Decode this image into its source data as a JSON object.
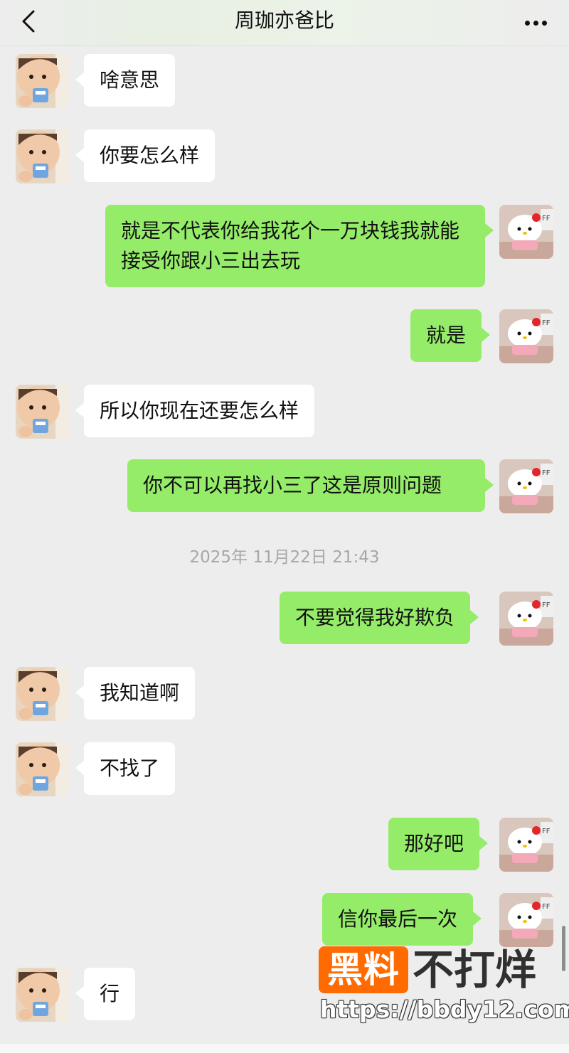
{
  "header": {
    "title": "周珈亦爸比",
    "back_icon": "chevron-left-icon",
    "more_icon": "ellipsis-icon"
  },
  "messages": [
    {
      "side": "left",
      "text": "啥意思"
    },
    {
      "side": "left",
      "text": "你要怎么样"
    },
    {
      "side": "right",
      "text": "就是不代表你给我花个一万块钱我就能接受你跟小三出去玩"
    },
    {
      "side": "right",
      "text": "就是"
    },
    {
      "side": "left",
      "text": "所以你现在还要怎么样"
    },
    {
      "side": "right",
      "text": "你不可以再找小三了这是原则问题"
    },
    {
      "side": "right",
      "text": "不要觉得我好欺负"
    },
    {
      "side": "left",
      "text": "我知道啊"
    },
    {
      "side": "left",
      "text": "不找了"
    },
    {
      "side": "right",
      "text": "那好吧"
    },
    {
      "side": "right",
      "text": "信你最后一次"
    },
    {
      "side": "left",
      "text": "行"
    }
  ],
  "timestamp": "2025年 11月22日 21:43",
  "watermark": {
    "badge": "黑料",
    "text": "不打烊",
    "url": "https://bbdy12.com"
  },
  "colors": {
    "sent_bubble": "#95ec69",
    "received_bubble": "#ffffff",
    "background": "#ededed",
    "watermark_badge": "#ff6b00"
  }
}
